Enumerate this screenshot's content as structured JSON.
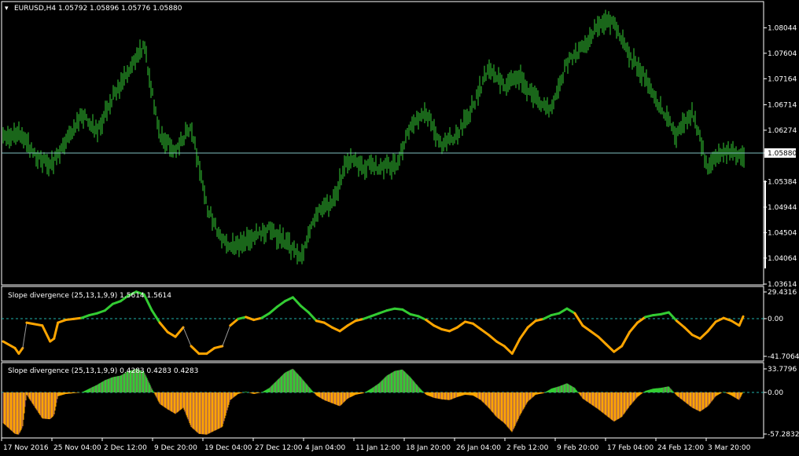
{
  "main": {
    "menu_icon": "triangle-down-icon",
    "header": "EURUSD,H4  1.05792 1.05896 1.05776 1.05880",
    "price_ticks": [
      "1.08044",
      "1.07604",
      "1.07164",
      "1.06714",
      "1.06274",
      "1.05880",
      "1.05384",
      "1.04944",
      "1.04504",
      "1.04064",
      "1.03614"
    ],
    "current_price": "1.05880"
  },
  "ind1": {
    "header": "Slope divergence (25,13,1,9,9) 1.5614 1.5614",
    "ticks": [
      "29.4316",
      "0.00",
      "-41.7064"
    ]
  },
  "ind2": {
    "header": "Slope divergence (25,13,1,9,9) 0.4283 0.4283 0.4283",
    "ticks": [
      "33.7796",
      "0.00",
      "-57.2832"
    ]
  },
  "time_labels": [
    "17 Nov 2016",
    "25 Nov 04:00",
    "2 Dec 12:00",
    "9 Dec 20:00",
    "19 Dec 04:00",
    "27 Dec 12:00",
    "4 Jan 04:00",
    "11 Jan 12:00",
    "18 Jan 20:00",
    "26 Jan 04:00",
    "2 Feb 12:00",
    "9 Feb 20:00",
    "17 Feb 04:00",
    "24 Feb 12:00",
    "3 Mar 20:00"
  ],
  "colors": {
    "bars": "#33cc33",
    "up": "#33cc33",
    "down": "#ffa500",
    "border": "#ffffff",
    "zero_line": "#20b2aa",
    "price_line": "#7fbfbf"
  },
  "chart_data": [
    {
      "type": "line",
      "series": [
        {
          "x": [
            0,
            20,
            40,
            60,
            80,
            100,
            120,
            140,
            160,
            180,
            200,
            220,
            240,
            260,
            280,
            300,
            320,
            340,
            360,
            380,
            400,
            420,
            440,
            460,
            480,
            500,
            520,
            540,
            560,
            580,
            600,
            620,
            640,
            660,
            680,
            700,
            720,
            740,
            760,
            780,
            800,
            820,
            840,
            860,
            880,
            900,
            920,
            940
          ],
          "y": [
            1.0615,
            1.0625,
            1.0585,
            1.0565,
            1.0605,
            1.0655,
            1.0625,
            1.0685,
            1.0725,
            1.0775,
            1.0615,
            1.0595,
            1.0635,
            1.0495,
            1.0435,
            1.0425,
            1.0445,
            1.0455,
            1.0435,
            1.0405,
            1.0485,
            1.05,
            1.0575,
            1.0565,
            1.0565,
            1.0565,
            1.063,
            1.066,
            1.06,
            1.062,
            1.067,
            1.0735,
            1.0705,
            1.072,
            1.068,
            1.0665,
            1.0745,
            1.077,
            1.0815,
            1.081,
            1.0755,
            1.072,
            1.0665,
            1.062,
            1.066,
            1.056,
            1.0595,
            1.058
          ]
        }
      ],
      "ylim": [
        1.03614,
        1.08484
      ]
    },
    {
      "type": "area",
      "series": [
        {
          "x": [
            0,
            15,
            20,
            25,
            30,
            50,
            60,
            65,
            70,
            80,
            90,
            100,
            110,
            120,
            130,
            140,
            150,
            160,
            170,
            180,
            190,
            200,
            210,
            220,
            230,
            240,
            250,
            260,
            270,
            280,
            290,
            300,
            310,
            320,
            330,
            340,
            350,
            360,
            370,
            380,
            390,
            400,
            410,
            420,
            430,
            440,
            450,
            460,
            470,
            480,
            490,
            500,
            510,
            520,
            530,
            540,
            550,
            560,
            570,
            580,
            590,
            600,
            610,
            620,
            630,
            640,
            650,
            660,
            670,
            680,
            690,
            700,
            710,
            720,
            730,
            740,
            750,
            760,
            770,
            780,
            790,
            800,
            810,
            820,
            830,
            840,
            850,
            860,
            870,
            880,
            890,
            900,
            910,
            920,
            930,
            940,
            945
          ],
          "y": [
            -25,
            -32,
            -38,
            -32,
            -5,
            -8,
            -25,
            -22,
            -5,
            -2,
            -1,
            0,
            3,
            5,
            8,
            15,
            18,
            24,
            28,
            25,
            8,
            -5,
            -15,
            -20,
            -10,
            -30,
            -38,
            -38,
            -32,
            -30,
            -8,
            -1,
            1,
            -2,
            0,
            5,
            12,
            18,
            22,
            13,
            6,
            -3,
            -5,
            -10,
            -14,
            -8,
            -3,
            -1,
            2,
            5,
            8,
            10,
            9,
            4,
            2,
            -2,
            -8,
            -12,
            -14,
            -10,
            -4,
            -6,
            -12,
            -18,
            -25,
            -30,
            -38,
            -22,
            -10,
            -3,
            -1,
            3,
            5,
            10,
            5,
            -8,
            -14,
            -20,
            -28,
            -36,
            -30,
            -15,
            -5,
            1,
            3,
            4,
            6,
            -3,
            -10,
            -18,
            -22,
            -14,
            -4,
            0,
            -3,
            -8,
            1.56
          ]
        }
      ],
      "ylim": [
        -41.7064,
        29.4316
      ]
    },
    {
      "type": "bar",
      "series": [
        {
          "x": [
            0,
            15,
            20,
            25,
            30,
            50,
            60,
            65,
            70,
            80,
            90,
            100,
            110,
            120,
            130,
            140,
            150,
            160,
            170,
            180,
            190,
            200,
            210,
            220,
            230,
            240,
            250,
            260,
            270,
            280,
            290,
            300,
            310,
            320,
            330,
            340,
            350,
            360,
            370,
            380,
            390,
            400,
            410,
            420,
            430,
            440,
            450,
            460,
            470,
            480,
            490,
            500,
            510,
            520,
            530,
            540,
            550,
            560,
            570,
            580,
            590,
            600,
            610,
            620,
            630,
            640,
            650,
            660,
            670,
            680,
            690,
            700,
            710,
            720,
            730,
            740,
            750,
            760,
            770,
            780,
            790,
            800,
            810,
            820,
            830,
            840,
            850,
            860,
            870,
            880,
            890,
            900,
            910,
            920,
            930,
            940,
            945
          ],
          "y": [
            -40,
            -54,
            -55,
            -45,
            -3,
            -34,
            -35,
            -30,
            -5,
            -2,
            -1,
            0,
            5,
            10,
            16,
            20,
            22,
            28,
            31,
            27,
            5,
            -15,
            -22,
            -28,
            -20,
            -45,
            -54,
            -55,
            -50,
            -45,
            -10,
            -2,
            1,
            -2,
            0,
            6,
            16,
            26,
            31,
            20,
            8,
            -4,
            -10,
            -14,
            -18,
            -8,
            -3,
            -1,
            5,
            12,
            22,
            28,
            30,
            20,
            8,
            -3,
            -7,
            -9,
            -10,
            -6,
            -3,
            -4,
            -10,
            -20,
            -32,
            -40,
            -52,
            -30,
            -12,
            -3,
            -1,
            5,
            8,
            12,
            6,
            -8,
            -15,
            -22,
            -30,
            -38,
            -32,
            -18,
            -6,
            2,
            5,
            6,
            8,
            -4,
            -12,
            -20,
            -25,
            -18,
            -5,
            1,
            -4,
            -10,
            0.43
          ]
        }
      ],
      "ylim": [
        -57.2832,
        33.7796
      ]
    }
  ]
}
